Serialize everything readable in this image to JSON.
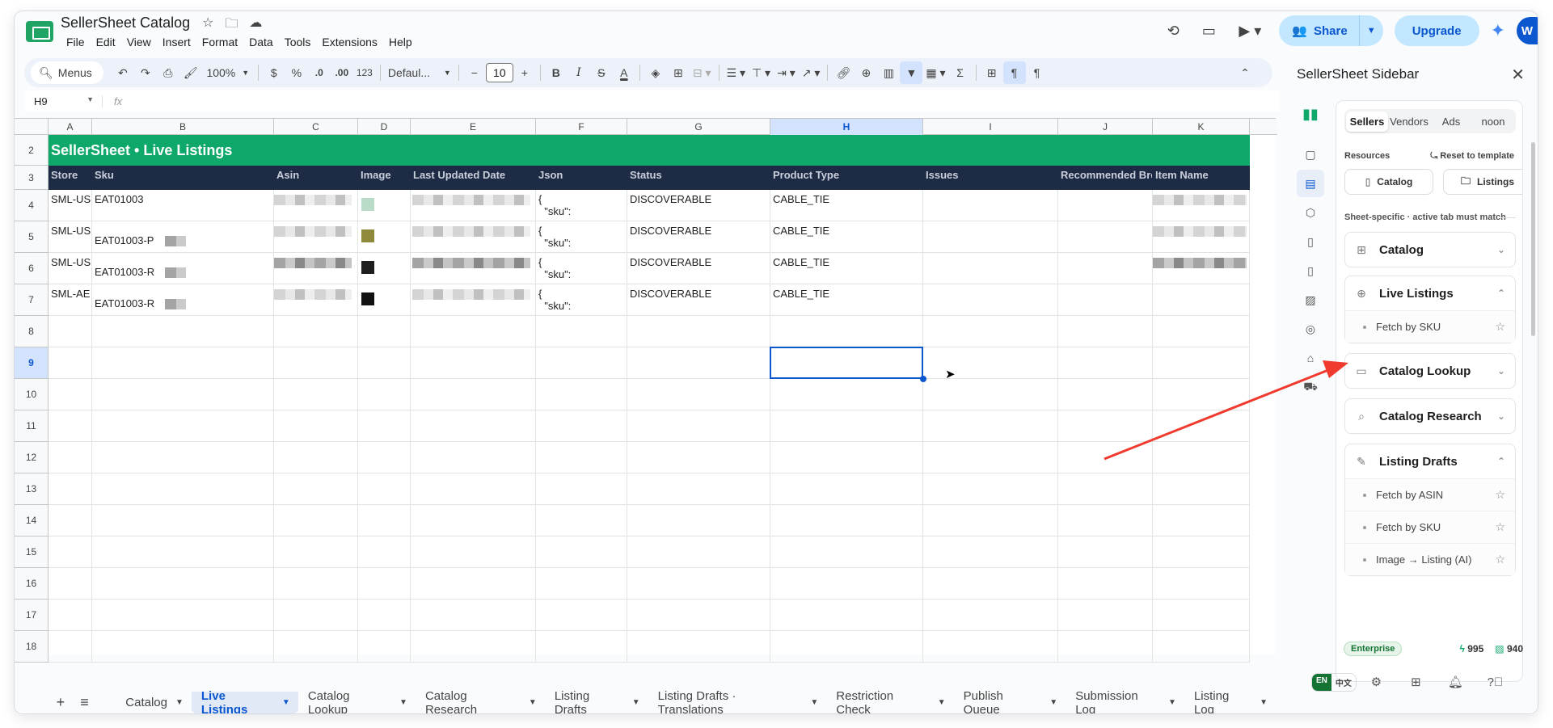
{
  "app": {
    "doc_title": "SellerSheet Catalog",
    "menu": [
      "File",
      "Edit",
      "View",
      "Insert",
      "Format",
      "Data",
      "Tools",
      "Extensions",
      "Help"
    ],
    "share_label": "Share",
    "upgrade_label": "Upgrade",
    "avatar_initial": "W"
  },
  "toolbar": {
    "menus_label": "Menus",
    "zoom": "100%",
    "currency": "$",
    "percent": "%",
    "dec_dec": ".0",
    "dec_inc": ".00",
    "number_format": "123",
    "font": "Defaul...",
    "font_size": "10",
    "bold": "B",
    "italic": "I",
    "strike": "S",
    "text_color": "A"
  },
  "formula_bar": {
    "cell_ref": "H9",
    "fx": "fx"
  },
  "grid": {
    "columns": [
      "A",
      "B",
      "C",
      "D",
      "E",
      "F",
      "G",
      "H",
      "I",
      "J",
      "K"
    ],
    "selected_column": "H",
    "rows": [
      "2",
      "3",
      "4",
      "5",
      "6",
      "7",
      "8",
      "9",
      "10",
      "11",
      "12",
      "13",
      "14",
      "15",
      "16",
      "17",
      "18"
    ],
    "selected_row": "9",
    "banner": "SellerSheet • Live Listings",
    "headers": [
      "Store",
      "Sku",
      "Asin",
      "Image",
      "Last Updated Date",
      "Json",
      "Status",
      "Product Type",
      "Issues",
      "Recommended Browse Nodes",
      "Item Name"
    ],
    "data_rows": [
      {
        "store": "SML-US",
        "sku": "EAT01003",
        "json": "{\n  \"sku\":",
        "status": "DISCOVERABLE",
        "product_type": "CABLE_TIE"
      },
      {
        "store": "SML-US",
        "sku": "EAT01003-P",
        "json": "{\n  \"sku\":",
        "status": "DISCOVERABLE",
        "product_type": "CABLE_TIE"
      },
      {
        "store": "SML-US",
        "sku": "EAT01003-R",
        "json": "{\n  \"sku\":",
        "status": "DISCOVERABLE",
        "product_type": "CABLE_TIE"
      },
      {
        "store": "SML-AE",
        "sku": "EAT01003-R",
        "json": "{\n  \"sku\":",
        "status": "DISCOVERABLE",
        "product_type": "CABLE_TIE"
      }
    ]
  },
  "sheet_tabs": [
    {
      "label": "Catalog",
      "active": false
    },
    {
      "label": "Live Listings",
      "active": true
    },
    {
      "label": "Catalog Lookup",
      "active": false
    },
    {
      "label": "Catalog Research",
      "active": false
    },
    {
      "label": "Listing Drafts",
      "active": false
    },
    {
      "label": "Listing Drafts · Translations",
      "active": false
    },
    {
      "label": "Restriction Check",
      "active": false
    },
    {
      "label": "Publish Queue",
      "active": false
    },
    {
      "label": "Submission Log",
      "active": false
    },
    {
      "label": "Listing Log",
      "active": false
    }
  ],
  "sidebar": {
    "title": "SellerSheet Sidebar",
    "segments": [
      "Sellers",
      "Vendors",
      "Ads",
      "noon"
    ],
    "active_segment": "Sellers",
    "resources_label": "Resources",
    "reset_label": "Reset to template",
    "resource_buttons": [
      "Catalog",
      "Listings"
    ],
    "sheet_note": "Sheet-specific · active tab must match",
    "sections": [
      {
        "title": "Catalog",
        "icon": "grid-icon",
        "expanded": false,
        "items": []
      },
      {
        "title": "Live Listings",
        "icon": "globe-icon",
        "expanded": true,
        "items": [
          "Fetch by SKU"
        ]
      },
      {
        "title": "Catalog Lookup",
        "icon": "book-icon",
        "expanded": false,
        "items": []
      },
      {
        "title": "Catalog Research",
        "icon": "search-icon",
        "expanded": false,
        "items": []
      },
      {
        "title": "Listing Drafts",
        "icon": "pencil-icon",
        "expanded": true,
        "items": [
          "Fetch by ASIN",
          "Fetch by SKU",
          "Image → Listing (AI)"
        ]
      }
    ],
    "plan_badge": "Enterprise",
    "credits_a": "995",
    "credits_b": "940",
    "lang_en": "EN",
    "lang_zh": "中文"
  }
}
